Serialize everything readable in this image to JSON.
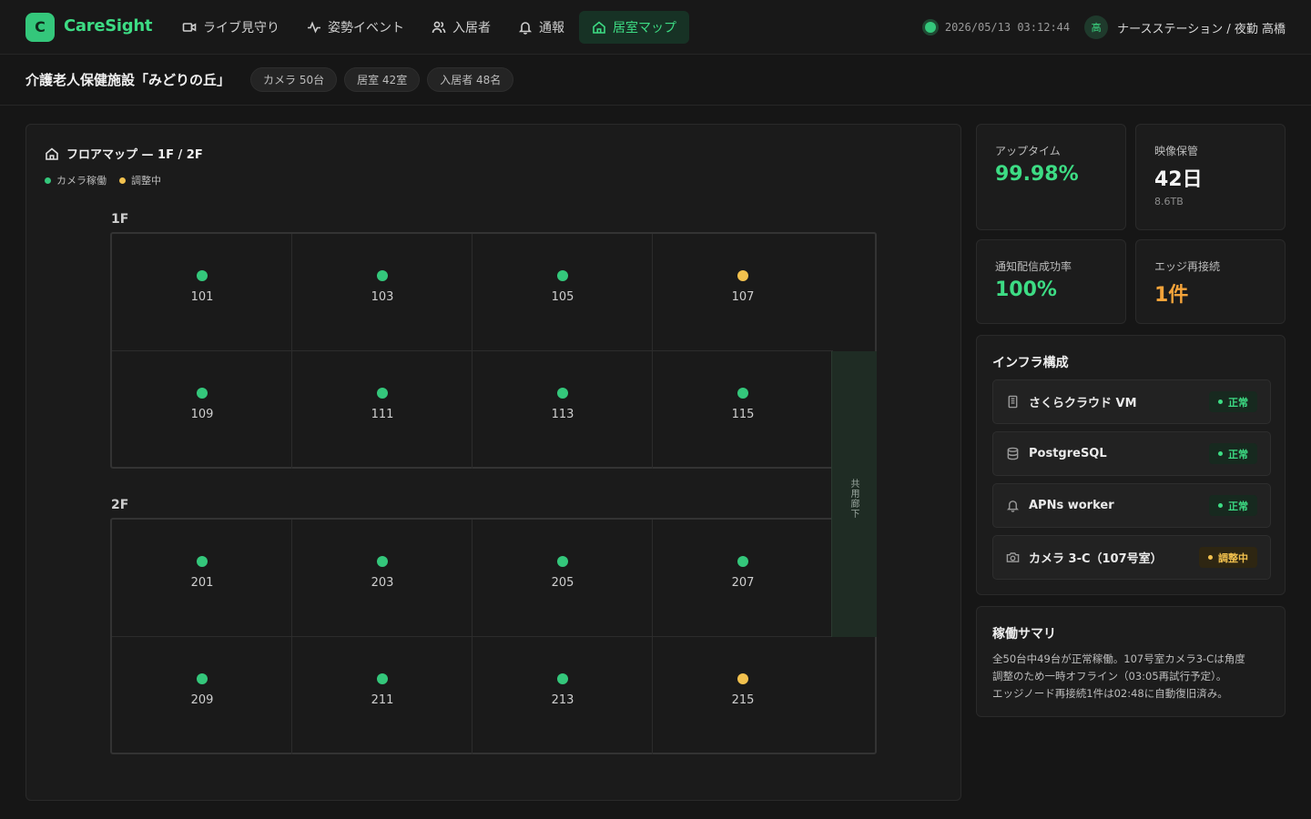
{
  "app": {
    "logo_letter": "C",
    "name": "CareSight"
  },
  "nav": [
    {
      "label": "ライブ見守り",
      "icon": "video-camera-icon"
    },
    {
      "label": "姿勢イベント",
      "icon": "activity-pulse-icon"
    },
    {
      "label": "入居者",
      "icon": "users-icon"
    },
    {
      "label": "通報",
      "icon": "bell-icon"
    },
    {
      "label": "居室マップ",
      "icon": "home-icon",
      "active": true
    }
  ],
  "header": {
    "datetime": "2026/05/13 03:12:44",
    "user_initial": "高",
    "user_label": "ナースステーション / 夜勤 高橋"
  },
  "facility": {
    "name": "介護老人保健施設「みどりの丘」",
    "chips": [
      "カメラ 50台",
      "居室 42室",
      "入居者 48名"
    ]
  },
  "map": {
    "title": "フロアマップ — 1F / 2F",
    "legend": {
      "active": "カメラ稼働",
      "adjusting": "調整中"
    },
    "corridor": "共用廊下",
    "floors": [
      {
        "label": "1F",
        "rooms": [
          {
            "num": "101",
            "status": "active"
          },
          {
            "num": "103",
            "status": "active"
          },
          {
            "num": "105",
            "status": "active"
          },
          {
            "num": "107",
            "status": "adjusting"
          },
          {
            "num": "109",
            "status": "active"
          },
          {
            "num": "111",
            "status": "active"
          },
          {
            "num": "113",
            "status": "active"
          },
          {
            "num": "115",
            "status": "active"
          }
        ]
      },
      {
        "label": "2F",
        "rooms": [
          {
            "num": "201",
            "status": "active"
          },
          {
            "num": "203",
            "status": "active"
          },
          {
            "num": "205",
            "status": "active"
          },
          {
            "num": "207",
            "status": "active"
          },
          {
            "num": "209",
            "status": "active"
          },
          {
            "num": "211",
            "status": "active"
          },
          {
            "num": "213",
            "status": "active"
          },
          {
            "num": "215",
            "status": "adjusting"
          }
        ]
      }
    ]
  },
  "stats": {
    "uptime": {
      "label": "アップタイム",
      "value": "99.98%"
    },
    "retention": {
      "label": "映像保管",
      "value": "42日",
      "sub": "8.6TB"
    },
    "delivery": {
      "label": "通知配信成功率",
      "value": "100%"
    },
    "reconnect": {
      "label": "エッジ再接続",
      "value": "1件"
    }
  },
  "infra": {
    "title": "インフラ構成",
    "items": [
      {
        "name": "さくらクラウド VM",
        "icon": "server-icon",
        "status": "正常"
      },
      {
        "name": "PostgreSQL",
        "icon": "database-icon",
        "status": "正常"
      },
      {
        "name": "APNs worker",
        "icon": "bell-icon",
        "status": "正常"
      },
      {
        "name": "カメラ 3-C（107号室）",
        "icon": "camera-icon",
        "status": "調整中"
      }
    ]
  },
  "summary": {
    "title": "稼働サマリ",
    "lines": [
      "全50台中49台が正常稼働。107号室カメラ3-Cは角度",
      "調整のため一時オフライン（03:05再試行予定）。",
      "エッジノード再接続1件は02:48に自動復旧済み。"
    ]
  },
  "colors": {
    "accent": "#3ddc84",
    "status_active": "#34c77b",
    "status_adjusting": "#f2c14e",
    "warning_text": "#f5a43a"
  }
}
